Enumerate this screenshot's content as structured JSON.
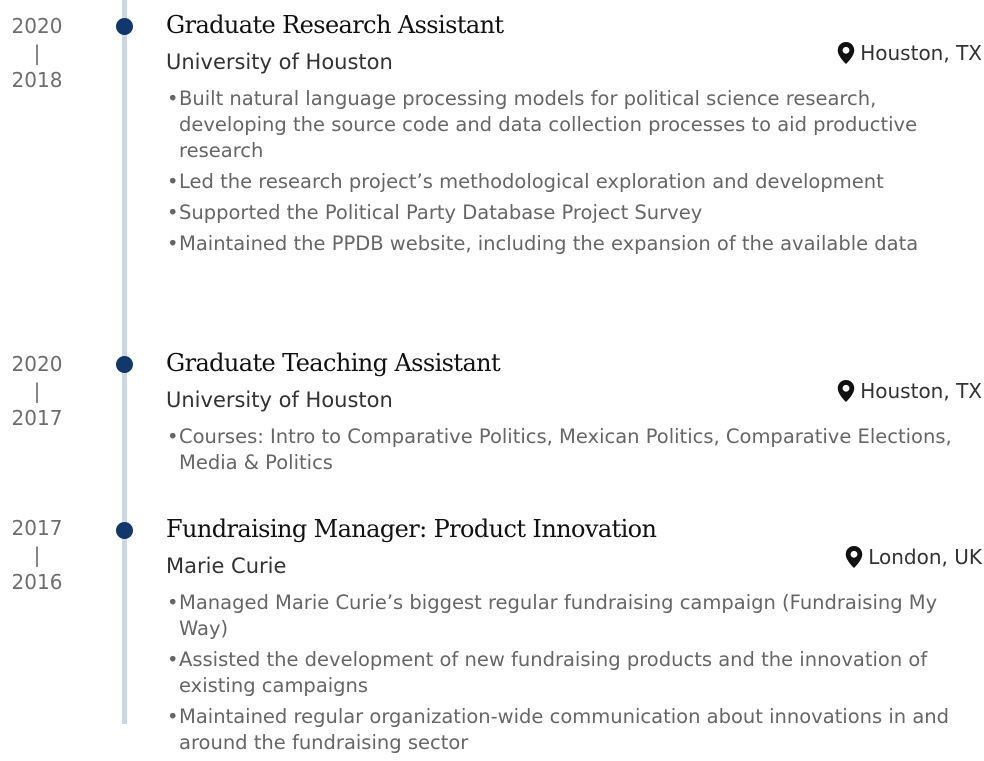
{
  "entries": [
    {
      "date_start": "2020",
      "date_sep": "|",
      "date_end": "2018",
      "title": "Graduate Research Assistant",
      "organization": "University of Houston",
      "location": "Houston, TX",
      "bullets": [
        "Built natural language processing models for political science research, developing the source code and data collection processes to aid productive research",
        "Led the research project’s methodological exploration and development",
        "Supported the Political Party Database Project Survey",
        "Maintained the PPDB website, including the expansion of the available data"
      ]
    },
    {
      "date_start": "2020",
      "date_sep": "|",
      "date_end": "2017",
      "title": "Graduate Teaching Assistant",
      "organization": "University of Houston",
      "location": "Houston, TX",
      "bullets": [
        "Courses: Intro to Comparative Politics, Mexican Politics, Comparative Elections, Media & Politics"
      ]
    },
    {
      "date_start": "2017",
      "date_sep": "|",
      "date_end": "2016",
      "title": "Fundraising Manager: Product Innovation",
      "organization": "Marie Curie",
      "location": "London, UK",
      "bullets": [
        "Managed Marie Curie’s biggest regular fundraising campaign (Fundraising My Way)",
        "Assisted the development of new fundraising products and the innovation of existing campaigns",
        "Maintained regular organization-wide communication about innovations in and around the fundraising sector"
      ]
    }
  ],
  "colors": {
    "timeline_line": "#c9d7e6",
    "timeline_dot": "#12386b",
    "title_text": "#111111",
    "body_text": "#666666"
  },
  "icons": {
    "location": "map-marker-icon"
  }
}
